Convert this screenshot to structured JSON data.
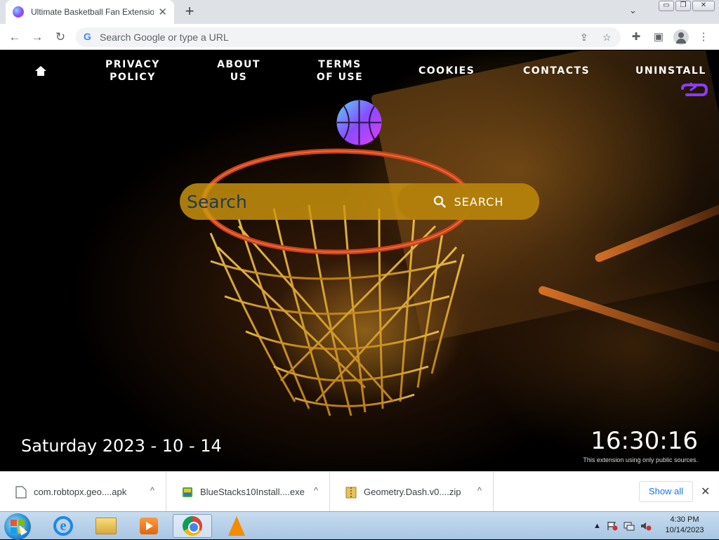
{
  "browser": {
    "tab_title": "Ultimate Basketball Fan Extension",
    "tab_close": "✕",
    "new_tab": "+",
    "tab_menu": "⌄",
    "window_buttons": {
      "minimize": "▭",
      "restore": "❐",
      "close": "✕"
    },
    "back": "←",
    "forward": "→",
    "reload": "↻",
    "omnibox_placeholder": "Search Google or type a URL",
    "google_g": "G",
    "share_icon": "⇪",
    "star_icon": "☆",
    "extensions_icon": "✚",
    "sidepanel_icon": "▣",
    "menu_icon": "⋮"
  },
  "page": {
    "nav": [
      {
        "line1": "PRIVACY",
        "line2": "POLICY"
      },
      {
        "line1": "ABOUT",
        "line2": "US"
      },
      {
        "line1": "TERMS",
        "line2": "OF USE"
      },
      {
        "line1": "COOKIES",
        "line2": ""
      },
      {
        "line1": "CONTACTS",
        "line2": ""
      },
      {
        "line1": "UNINSTALL",
        "line2": ""
      }
    ],
    "search": {
      "placeholder": "Search",
      "button_label": "SEARCH"
    },
    "date": "Saturday 2023 - 10 - 14",
    "time": "16:30:16",
    "disclaimer": "This extension using only public sources."
  },
  "downloads": {
    "items": [
      {
        "name": "com.robtopx.geo....apk"
      },
      {
        "name": "BlueStacks10Install....exe"
      },
      {
        "name": "Geometry.Dash.v0....zip"
      }
    ],
    "caret": "^",
    "show_all": "Show all",
    "close": "✕"
  },
  "taskbar": {
    "ie_glyph": "e",
    "tray_arrow": "▲",
    "tray_time": "4:30 PM",
    "tray_date": "10/14/2023"
  },
  "colors": {
    "search_bar": "#cd960f",
    "search_text": "#1f3a56",
    "uninstall_icon": "#8a3cff",
    "link_blue": "#1a73e8"
  }
}
